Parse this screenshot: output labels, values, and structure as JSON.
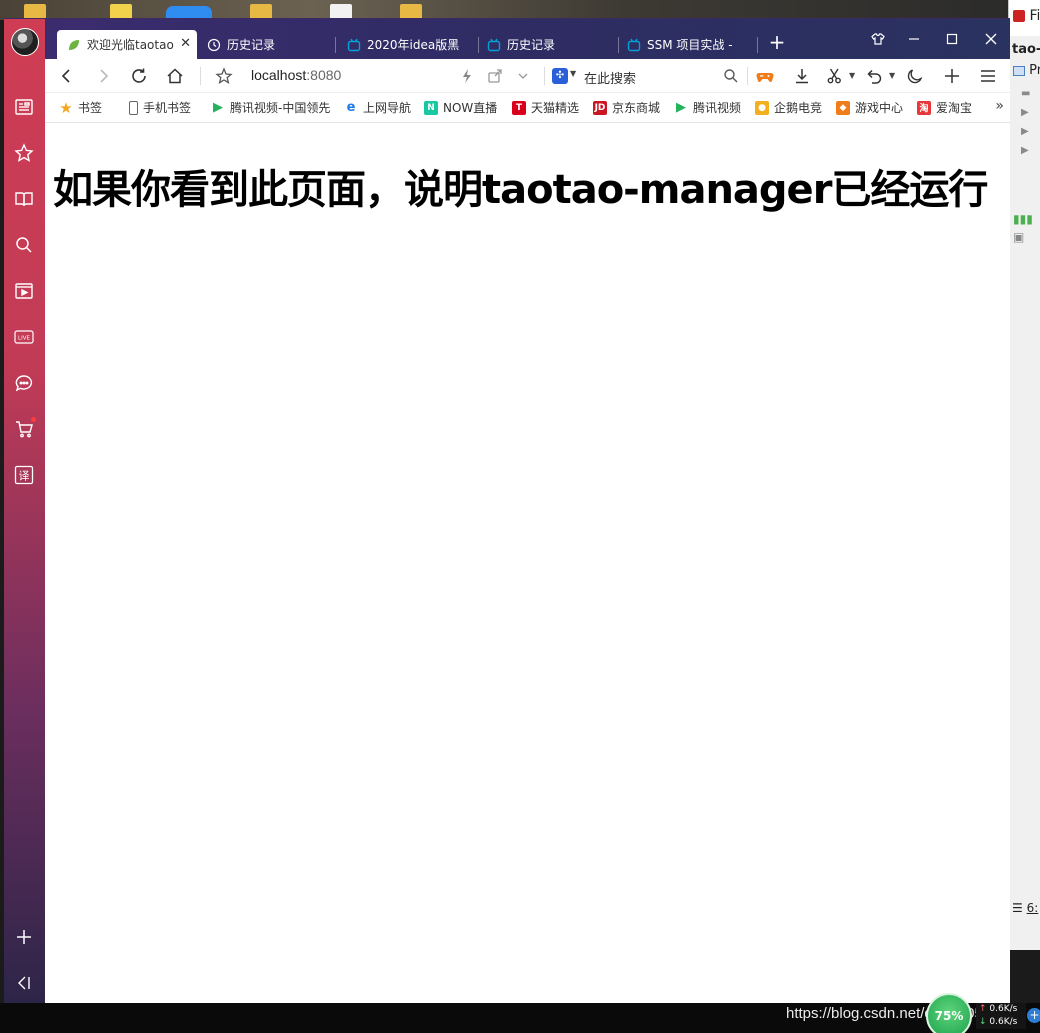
{
  "browser": {
    "tabs": [
      {
        "label": "欢迎光临taotao",
        "active": true,
        "icon": "leaf-icon"
      },
      {
        "label": "历史记录",
        "active": false,
        "icon": "clock-icon"
      },
      {
        "label": "2020年idea版黑",
        "active": false,
        "icon": "bilibili-icon"
      },
      {
        "label": "历史记录",
        "active": false,
        "icon": "bilibili-icon"
      },
      {
        "label": "SSM 项目实战 -",
        "active": false,
        "icon": "bilibili-icon"
      }
    ],
    "address": {
      "host": "localhost",
      "port": ":8080"
    },
    "search_placeholder": "在此搜索",
    "bookmarks": [
      {
        "label": "书签",
        "icon": "star-icon",
        "color": "#f5a623"
      },
      {
        "label": "手机书签",
        "icon": "phone-icon",
        "color": "#666666"
      },
      {
        "label": "腾讯视频-中国领先",
        "icon": "tencent-video-icon",
        "color": "#24b35c"
      },
      {
        "label": "上网导航",
        "icon": "ie-icon",
        "color": "#1e7ee6"
      },
      {
        "label": "NOW直播",
        "icon": "now-icon",
        "color": "#18c8a0"
      },
      {
        "label": "天猫精选",
        "icon": "tmall-icon",
        "color": "#d9001b"
      },
      {
        "label": "京东商城",
        "icon": "jd-icon",
        "color": "#c81623"
      },
      {
        "label": "腾讯视频",
        "icon": "tencent-video-icon",
        "color": "#24b35c"
      },
      {
        "label": "企鹅电竞",
        "icon": "esports-icon",
        "color": "#f2b01e"
      },
      {
        "label": "游戏中心",
        "icon": "gamepad-icon",
        "color": "#f07c1a"
      },
      {
        "label": "爱淘宝",
        "icon": "taobao-icon",
        "color": "#e8373a"
      }
    ]
  },
  "page": {
    "heading": "如果你看到此页面，说明taotao-manager已经运行"
  },
  "ide": {
    "menu_file": "File",
    "project_fragment": "tao-p",
    "panel_label": "Pr",
    "bottom_label": "6:"
  },
  "taskbar": {
    "watermark": "https://blog.csdn.net/qq_4605",
    "net_percent": "75%",
    "up_speed": "0.6K/s",
    "down_speed": "0.6K/s"
  }
}
